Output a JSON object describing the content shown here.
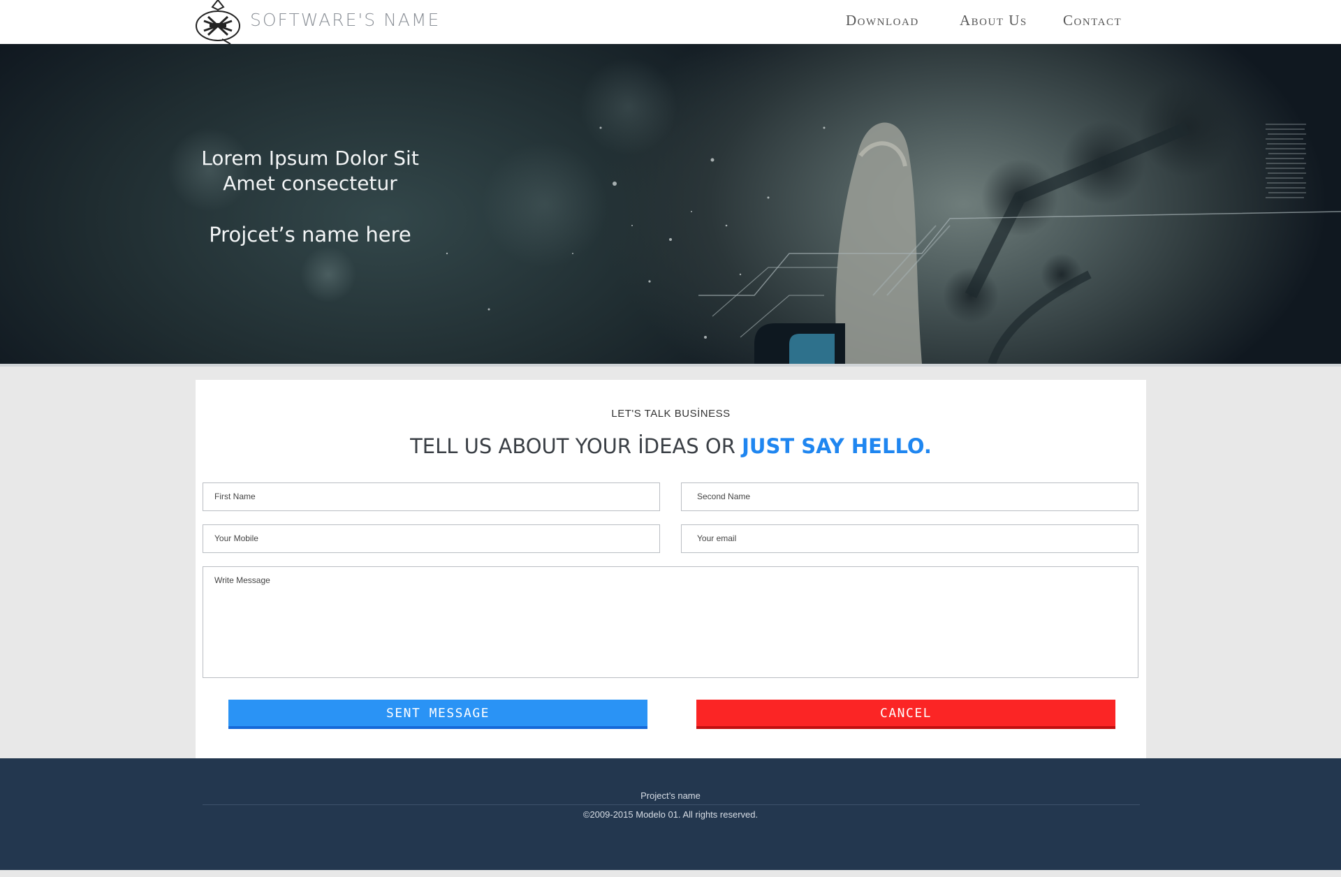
{
  "header": {
    "brand": "SOFTWARE'S NAME",
    "nav": [
      {
        "label": "Download"
      },
      {
        "label": "About Us"
      },
      {
        "label": "Contact"
      }
    ]
  },
  "hero": {
    "headline_line1": "Lorem Ipsum Dolor Sit",
    "headline_line2": "Amet consectetur",
    "project_name": "Projcet’s name here"
  },
  "contact": {
    "eyebrow": "LET'S TALK BUSİNESS",
    "heading_prefix": "TELL US ABOUT YOUR İDEAS OR ",
    "heading_accent": "JUST SAY HELLO.",
    "fields": {
      "first_name": "First Name",
      "second_name": "Second Name",
      "mobile": "Your Mobile",
      "email": "Your email",
      "message": "Write Message"
    },
    "send_label": "SENT MESSAGE",
    "cancel_label": "CANCEL"
  },
  "footer": {
    "project": "Project’s name",
    "copyright": "©2009-2015 Modelo 01. All rights reserved."
  },
  "colors": {
    "accent": "#1f86f0",
    "send": "#2a93f5",
    "cancel": "#fb2525",
    "footer": "#23374f"
  }
}
